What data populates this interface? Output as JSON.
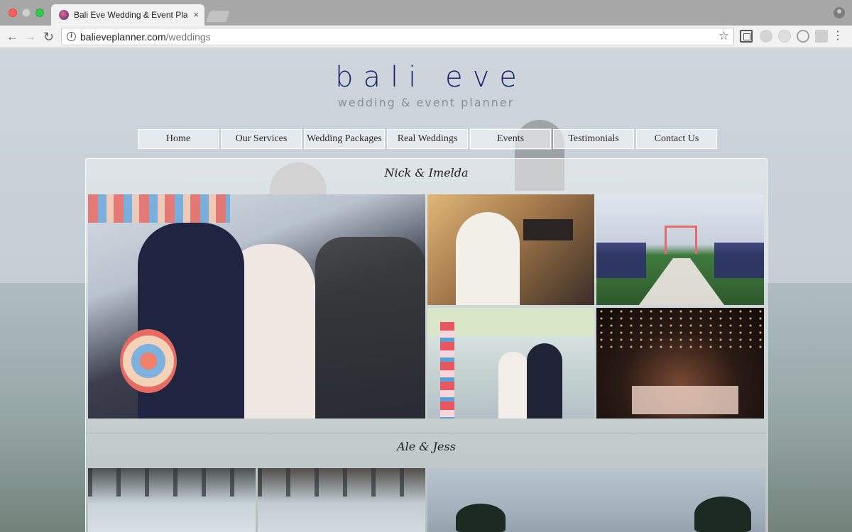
{
  "browser": {
    "tab_title": "Bali Eve Wedding & Event Planner",
    "tab_close": "×",
    "url_domain": "balieveplanner.com",
    "url_path": "/weddings",
    "back": "←",
    "forward": "→",
    "reload": "↻",
    "star": "☆",
    "menu": "⋮",
    "info": "i"
  },
  "logo": {
    "main": "bali eve",
    "sub": "wedding & event planner"
  },
  "nav": {
    "items": [
      "Home",
      "Our Services",
      "Wedding Packages",
      "Real Weddings",
      "Events",
      "Testimonials",
      "Contact Us"
    ]
  },
  "weddings": [
    {
      "couple": "Nick & Imelda"
    },
    {
      "couple": "Ale & Jess"
    }
  ],
  "icons": {
    "site_favicon": "site-favicon-icon",
    "info": "info-icon",
    "bookmark": "star-icon",
    "cast": "cast-icon",
    "extensions": [
      "extension-icon",
      "extension-icon",
      "extension-icon",
      "extension-icon"
    ],
    "profile": "profile-icon"
  },
  "colors": {
    "brand": "#1f2470",
    "brand_sub": "#8a8f97"
  }
}
